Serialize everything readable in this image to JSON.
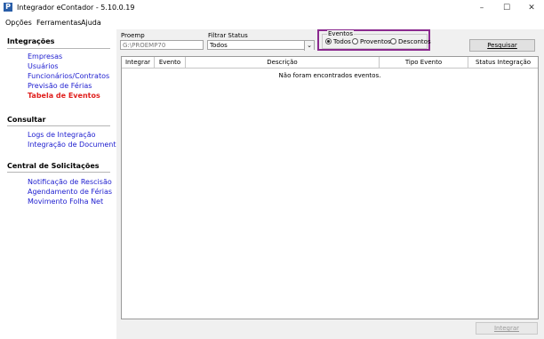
{
  "window": {
    "title": "Integrador eContador - 5.10.0.19",
    "icon_letter": "P",
    "controls": {
      "minimize": "–",
      "maximize": "☐",
      "close": "✕"
    }
  },
  "menu": [
    "Opções",
    "Ferramentas",
    "Ajuda"
  ],
  "sidebar": {
    "sections": [
      {
        "title": "Integrações",
        "items": [
          "Empresas",
          "Usuários",
          "Funcionários/Contratos",
          "Previsão de Férias",
          "Tabela de Eventos"
        ]
      },
      {
        "title": "Consultar",
        "items": [
          "Logs de Integração",
          "Integração de Documentos"
        ]
      },
      {
        "title": "Central de Solicitações",
        "items": [
          "Notificação de Rescisão",
          "Agendamento de Férias",
          "Movimento Folha Net"
        ]
      }
    ],
    "active_item": "Tabela de Eventos"
  },
  "filters": {
    "proemp_label": "Proemp",
    "proemp_value": "G:\\PROEMP70",
    "status_label": "Filtrar Status",
    "status_value": "Todos",
    "eventos_legend": "Eventos",
    "eventos_options": [
      "Todos",
      "Proventos",
      "Descontos"
    ],
    "eventos_selected": "Todos",
    "search_button": "Pesquisar"
  },
  "grid": {
    "columns": [
      "Integrar",
      "Evento",
      "Descrição",
      "Tipo Evento",
      "Status Integração"
    ],
    "empty_message": "Não foram encontrados eventos."
  },
  "footer": {
    "integrar_button": "Integrar"
  },
  "colors": {
    "link": "#1c1ccf",
    "active_link": "#e0201e",
    "highlight_border": "#8b2a8f"
  }
}
